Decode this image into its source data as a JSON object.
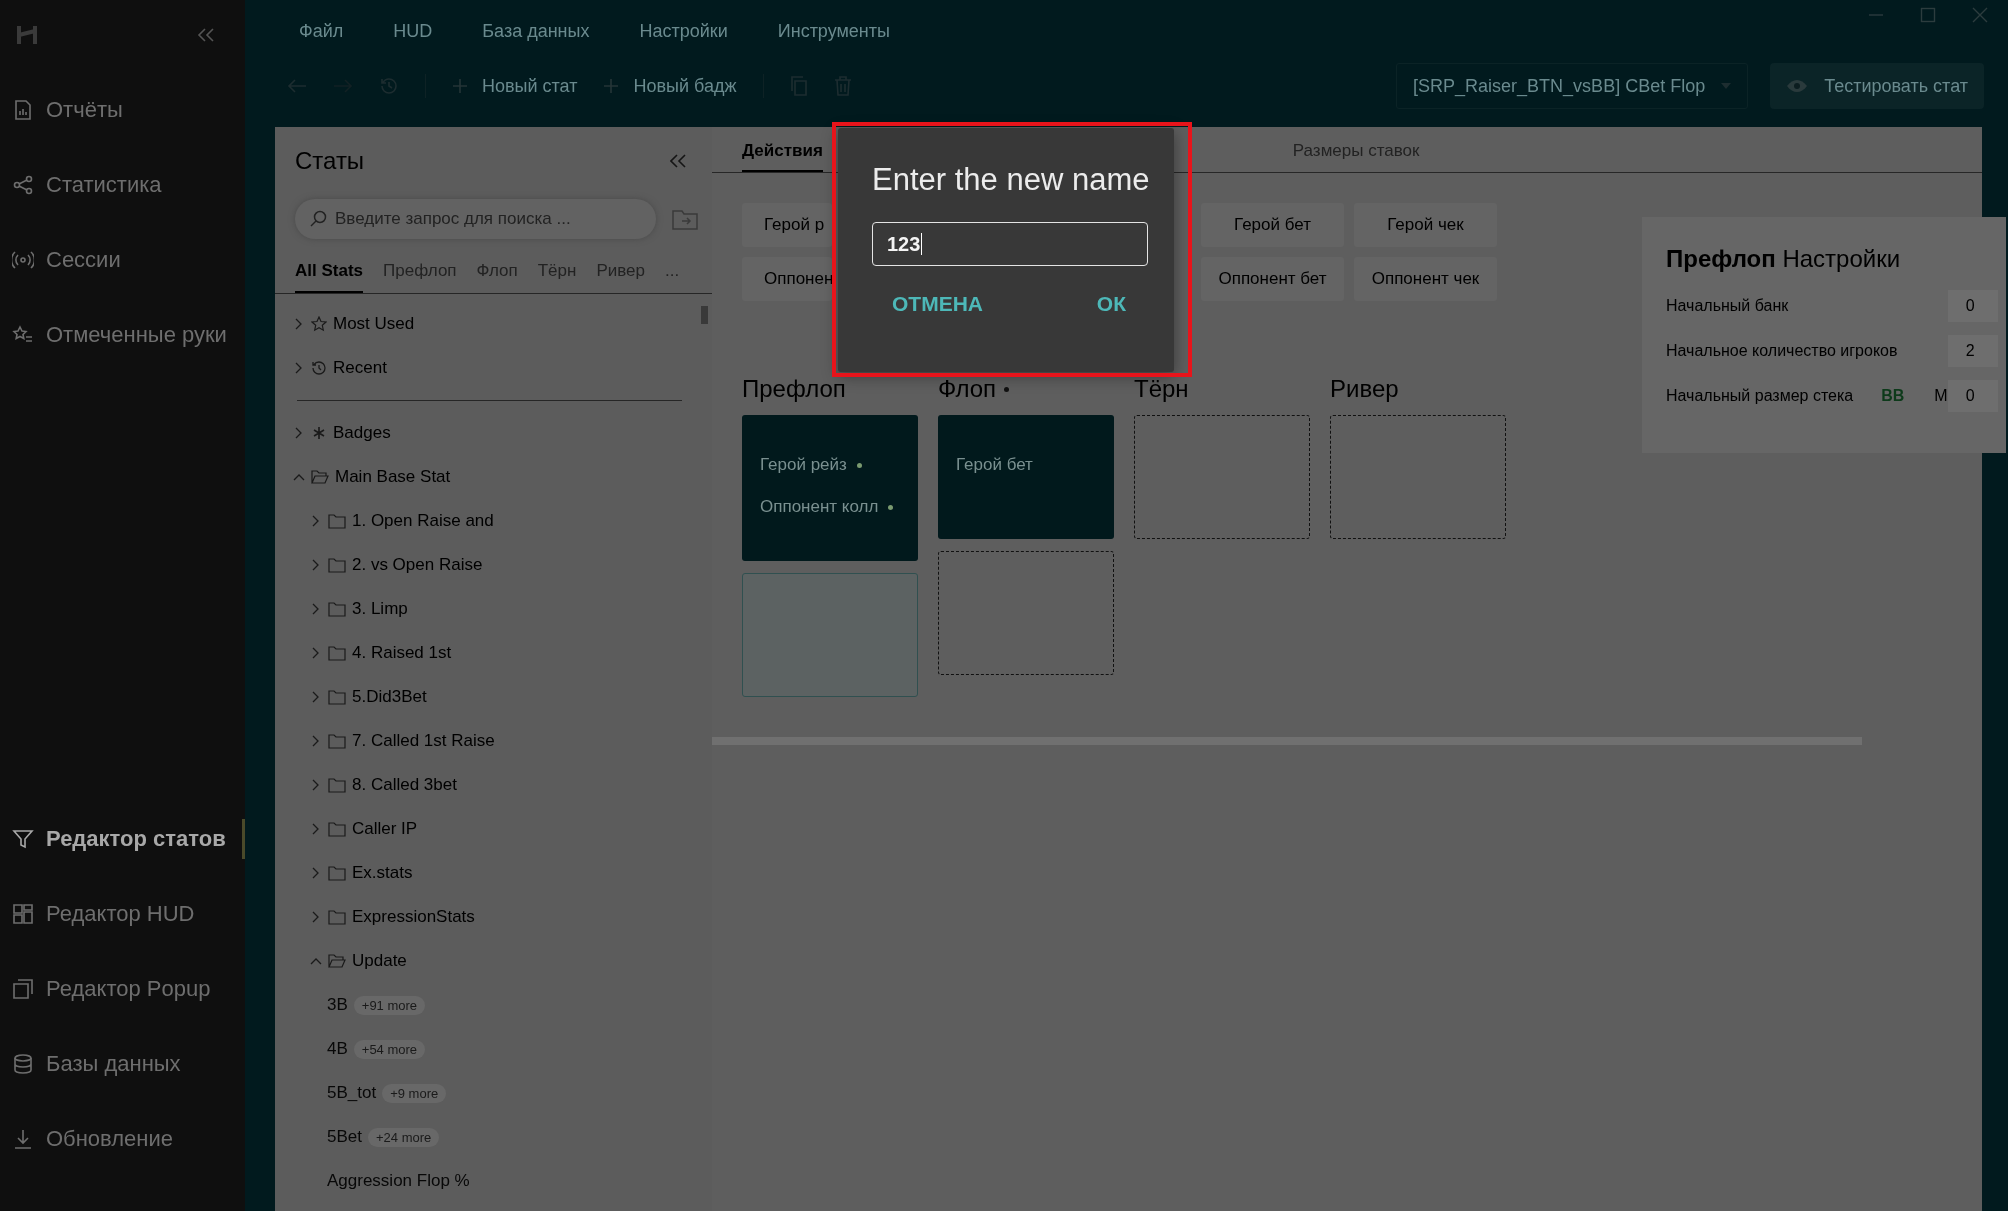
{
  "nav": {
    "top": [
      {
        "label": "Отчёты",
        "selected": false
      },
      {
        "label": "Статистика",
        "selected": false
      },
      {
        "label": "Сессии",
        "selected": false
      },
      {
        "label": "Отмеченные руки",
        "selected": false
      }
    ],
    "bottom": [
      {
        "label": "Редактор статов",
        "selected": true
      },
      {
        "label": "Редактор HUD",
        "selected": false
      },
      {
        "label": "Редактор Popup",
        "selected": false
      },
      {
        "label": "Базы данных",
        "selected": false
      },
      {
        "label": "Обновление",
        "selected": false
      }
    ]
  },
  "menu": [
    "Файл",
    "HUD",
    "База данных",
    "Настройки",
    "Инструменты"
  ],
  "toolbar": {
    "new_stat": "Новый стат",
    "new_badge": "Новый бадж",
    "stat_select": "[SRP_Raiser_BTN_vsBB] CBet Flop",
    "test_button": "Тестировать стат"
  },
  "stats_panel": {
    "title": "Статы",
    "search": {
      "placeholder": "Введите запрос для поиска ..."
    },
    "tabs": [
      {
        "label": "All Stats",
        "selected": true
      },
      {
        "label": "Префлоп",
        "selected": false
      },
      {
        "label": "Флоп",
        "selected": false
      },
      {
        "label": "Тёрн",
        "selected": false
      },
      {
        "label": "Ривер",
        "selected": false
      },
      {
        "label": "...",
        "selected": false
      }
    ],
    "tree": [
      {
        "label": "Most Used",
        "kind": "favorites",
        "expanded": false
      },
      {
        "label": "Recent",
        "kind": "recent",
        "expanded": false
      },
      {
        "label": "Badges",
        "kind": "badges",
        "expanded": false
      },
      {
        "label": "Main Base Stat",
        "kind": "folder",
        "expanded": true,
        "children": [
          {
            "label": "1. Open Raise and",
            "kind": "folder",
            "expanded": false
          },
          {
            "label": "2. vs Open Raise",
            "kind": "folder",
            "expanded": false
          },
          {
            "label": "3. Limp",
            "kind": "folder",
            "expanded": false
          },
          {
            "label": "4. Raised 1st",
            "kind": "folder",
            "expanded": false
          },
          {
            "label": "5.Did3Bet",
            "kind": "folder",
            "expanded": false
          },
          {
            "label": "7. Called 1st Raise",
            "kind": "folder",
            "expanded": false
          },
          {
            "label": "8. Called 3bet",
            "kind": "folder",
            "expanded": false
          },
          {
            "label": "Caller IP",
            "kind": "folder",
            "expanded": false
          },
          {
            "label": "Ex.stats",
            "kind": "folder",
            "expanded": false
          },
          {
            "label": "ExpressionStats",
            "kind": "folder",
            "expanded": false
          },
          {
            "label": "Update",
            "kind": "folder",
            "expanded": true,
            "children": [
              {
                "label": "3B",
                "kind": "stat",
                "badge": "+91 more"
              },
              {
                "label": "4B",
                "kind": "stat",
                "badge": "+54 more"
              },
              {
                "label": "5B_tot",
                "kind": "stat",
                "badge": "+9 more"
              },
              {
                "label": "5Bet",
                "kind": "stat",
                "badge": "+24 more"
              },
              {
                "label": "Aggression Flop %",
                "kind": "stat"
              }
            ]
          }
        ]
      }
    ]
  },
  "editor": {
    "tabs": [
      {
        "label": "Действия",
        "selected": true
      },
      {
        "label": "Размеры ставок",
        "selected": false
      }
    ],
    "action_rows": [
      [
        "Герой р",
        null,
        null,
        "Герой бет",
        "Герой чек"
      ],
      [
        "Оппонен",
        null,
        null,
        "Оппонент бет",
        "Оппонент чек"
      ]
    ],
    "streets": [
      {
        "name": "Префлоп",
        "dot": false,
        "cards": [
          {
            "kind": "filled",
            "items": [
              {
                "label": "Герой рейз",
                "dot": true
              },
              {
                "label": "Оппонент колл",
                "dot": true
              }
            ]
          },
          {
            "kind": "solid"
          }
        ]
      },
      {
        "name": "Флоп",
        "dot": true,
        "cards": [
          {
            "kind": "filled",
            "items": [
              {
                "label": "Герой бет",
                "dot": false
              }
            ]
          },
          {
            "kind": "dashed"
          }
        ]
      },
      {
        "name": "Тёрн",
        "dot": false,
        "cards": [
          {
            "kind": "dashed"
          }
        ]
      },
      {
        "name": "Ривер",
        "dot": false,
        "cards": [
          {
            "kind": "dashed"
          }
        ]
      }
    ]
  },
  "settings": {
    "title_bold": "Префлоп",
    "title": "Настройки",
    "rows": [
      {
        "label": "Начальный банк",
        "value": "0"
      },
      {
        "label": "Начальное количество игроков",
        "value": "2"
      },
      {
        "label": "Начальный размер стека",
        "value": "0",
        "units": [
          {
            "label": "BB",
            "selected": true
          },
          {
            "label": "M",
            "selected": false
          }
        ]
      }
    ]
  },
  "dialog": {
    "title": "Enter the new name",
    "value": "123",
    "cancel": "ОТМЕНА",
    "ok": "ОК"
  }
}
